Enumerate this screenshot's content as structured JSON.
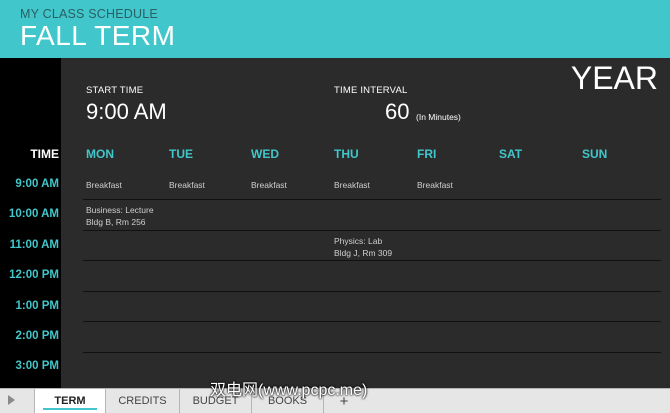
{
  "header": {
    "subtitle": "MY CLASS SCHEDULE",
    "title": "FALL TERM"
  },
  "settings": {
    "start_time_label": "START TIME",
    "start_time_value": "9:00 AM",
    "interval_label": "TIME INTERVAL",
    "interval_value": "60",
    "interval_unit": "(In Minutes)",
    "year": "YEAR"
  },
  "grid": {
    "time_header": "TIME",
    "days": [
      "MON",
      "TUE",
      "WED",
      "THU",
      "FRI",
      "SAT",
      "SUN"
    ],
    "times": [
      "9:00 AM",
      "10:00 AM",
      "11:00 AM",
      "12:00 PM",
      "1:00 PM",
      "2:00 PM",
      "3:00 PM"
    ],
    "cells": {
      "mon_9": "Breakfast",
      "tue_9": "Breakfast",
      "wed_9": "Breakfast",
      "thu_9": "Breakfast",
      "fri_9": "Breakfast",
      "mon_10_a": "Business: Lecture",
      "mon_10_b": "Bldg B, Rm 256",
      "thu_11_a": "Physics: Lab",
      "thu_11_b": "Bldg J, Rm 309"
    }
  },
  "tabs": [
    "TERM",
    "CREDITS",
    "BUDGET",
    "BOOKS"
  ],
  "tab_add": "+",
  "watermark": "双电网(www.pcpc.me)",
  "colors": {
    "accent": "#41c7cb",
    "panel": "#2b2b2b",
    "strip": "#000000"
  }
}
